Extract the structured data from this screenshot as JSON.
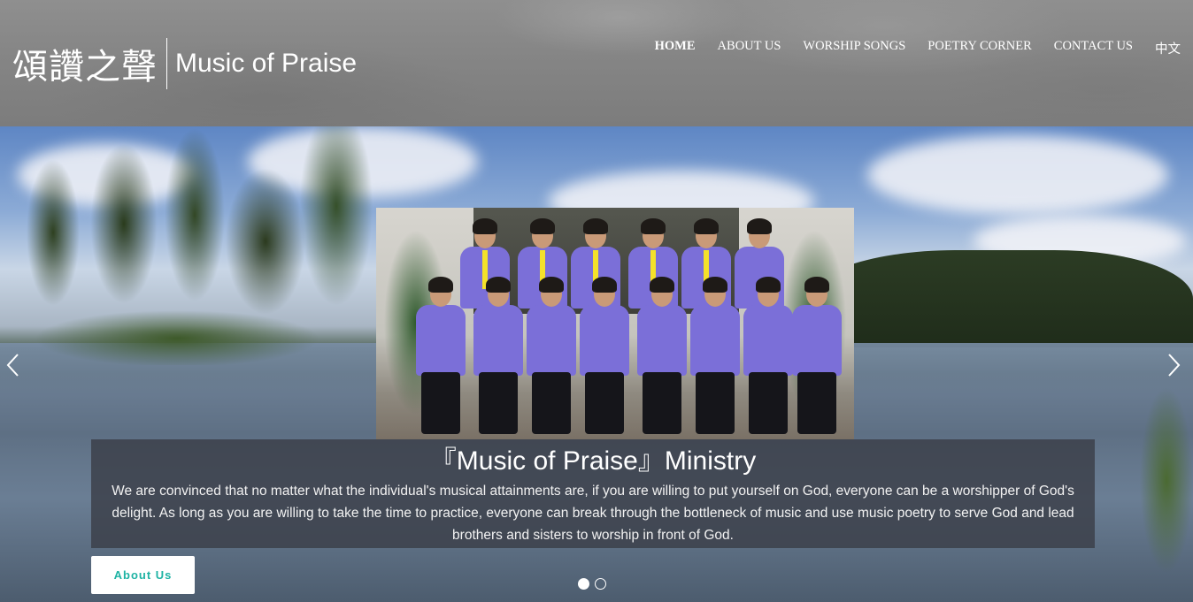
{
  "header": {
    "logo_cn": "頌讚之聲",
    "logo_en": "Music of Praise",
    "nav": [
      {
        "label": "HOME",
        "active": true
      },
      {
        "label": "ABOUT US",
        "active": false
      },
      {
        "label": "WORSHIP SONGS",
        "active": false
      },
      {
        "label": "POETRY CORNER",
        "active": false
      },
      {
        "label": "CONTACT US",
        "active": false
      },
      {
        "label": "中文",
        "active": false
      }
    ]
  },
  "slider": {
    "title": "『Music of Praise』Ministry",
    "text": "We are convinced that no matter what the individual's musical attainments are, if you are willing to put yourself on God, everyone can be a worshipper of God's delight. As long as you are willing to take the time to practice, everyone can break through the bottleneck of music and use music poetry to serve God and lead brothers and sisters to worship in front of God.",
    "button_label": "About Us",
    "slide_count": 2,
    "active_slide": 1,
    "prev_icon": "chevron-left-icon",
    "next_icon": "chevron-right-icon"
  },
  "colors": {
    "accent": "#1fb3a4",
    "uniform": "#7b6fd8",
    "tie": "#f4e12a"
  }
}
